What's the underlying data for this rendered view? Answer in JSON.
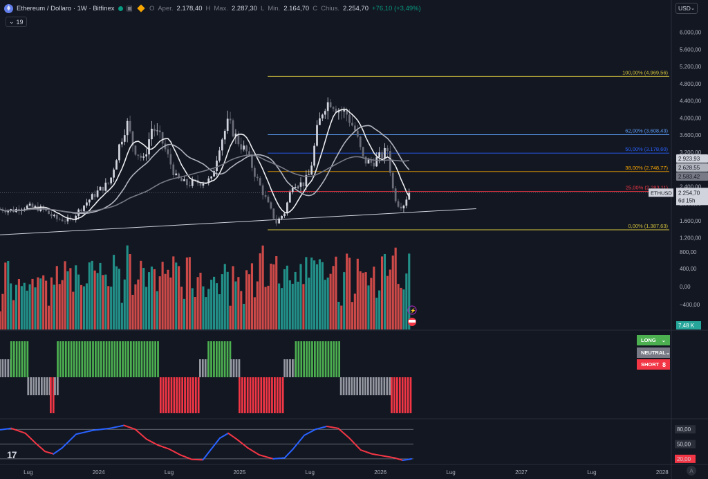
{
  "header": {
    "symbol": "Ethereum / Dollaro · 1W · Bitfinex",
    "open_label": "O",
    "open_key": "Aper.",
    "open": "2.178,40",
    "high_label": "H",
    "high_key": "Max.",
    "high": "2.287,30",
    "low_label": "L",
    "low_key": "Min.",
    "low": "2.164,70",
    "close_label": "C",
    "close_key": "Chius.",
    "close": "2.254,70",
    "change": "+76,10 (+3,49%)"
  },
  "indicator_count": "19",
  "currency": "USD",
  "price_tag": {
    "label": "ETHUSD",
    "price": "2.254,70",
    "countdown": "6d 15h"
  },
  "ma_tags": [
    "2.923,93",
    "2.628,55",
    "2.583,42"
  ],
  "volume_tag": "7,48 K",
  "signal_pills": {
    "long": "LONG",
    "neutral": "NEUTRAL",
    "short": "SHORT",
    "short_count": "8"
  },
  "osc_tags": [
    "80,00",
    "50,00",
    "20,00"
  ],
  "colors": {
    "bg": "#131722",
    "up": "#26a69a",
    "down": "#ef5350",
    "long": "#4caf50",
    "short": "#f23645",
    "neutral": "#9598a1",
    "osc_up": "#2962ff",
    "osc_down": "#f23645",
    "fib_yellow": "#d6c43c",
    "fib_orange": "#f7a600",
    "fib_blue": "#2962ff"
  },
  "icons": [
    "ethereum-coin-icon",
    "market-status-dot-icon",
    "favorite-icon",
    "flag-diamond-icon",
    "chevron-down-icon",
    "lightning-icon",
    "us-flag-icon",
    "tradingview-logo-icon"
  ],
  "chart_data": {
    "type": "candlestick",
    "axis": {
      "price_ticks": [
        "6.000,00",
        "5.600,00",
        "5.200,00",
        "4.800,00",
        "4.400,00",
        "4.000,00",
        "3.600,00",
        "3.200,00",
        "2.800,00",
        "2.400,00",
        "2.000,00",
        "1.600,00",
        "1.200,00"
      ],
      "price_range": [
        1000,
        6300
      ],
      "volume_ticks": [
        "800,00",
        "400,00",
        "0,00",
        "−400,00"
      ],
      "x_ticks": [
        {
          "label": "Lug",
          "t": 2023.5
        },
        {
          "label": "2024",
          "t": 2024.0
        },
        {
          "label": "Lug",
          "t": 2024.5
        },
        {
          "label": "2025",
          "t": 2025.0
        },
        {
          "label": "Lug",
          "t": 2025.5
        },
        {
          "label": "2026",
          "t": 2026.0
        },
        {
          "label": "Lug",
          "t": 2026.5
        },
        {
          "label": "2027",
          "t": 2027.0
        },
        {
          "label": "Lug",
          "t": 2027.5
        },
        {
          "label": "2028",
          "t": 2028.0
        }
      ],
      "x_range": [
        2023.3,
        2028.06
      ]
    },
    "fib_levels": [
      {
        "label": "100,00% (4.969,56)",
        "value": 4969.56,
        "color": "#d6c43c"
      },
      {
        "label": "62,00% (3.608,43)",
        "value": 3608.43,
        "color": "#5b9cf6"
      },
      {
        "label": "50,00% (3.178,60)",
        "value": 3178.6,
        "color": "#2962ff"
      },
      {
        "label": "38,00% (2.748,77)",
        "value": 2748.77,
        "color": "#f7a600"
      },
      {
        "label": "25,00% (2.283,11)",
        "value": 2283.11,
        "color": "#f23645"
      },
      {
        "label": "0,00% (1.387,63)",
        "value": 1387.63,
        "color": "#d6c43c"
      }
    ],
    "trendline": [
      {
        "t": 2023.3,
        "p": 1270
      },
      {
        "t": 2026.68,
        "p": 1880
      }
    ],
    "close_keypoints": [
      {
        "t": 2023.3,
        "p": 1870
      },
      {
        "t": 2023.4,
        "p": 1840
      },
      {
        "t": 2023.45,
        "p": 1920
      },
      {
        "t": 2023.5,
        "p": 1930
      },
      {
        "t": 2023.6,
        "p": 1870
      },
      {
        "t": 2023.7,
        "p": 1640
      },
      {
        "t": 2023.8,
        "p": 1600
      },
      {
        "t": 2023.85,
        "p": 1800
      },
      {
        "t": 2023.92,
        "p": 2050
      },
      {
        "t": 2024.0,
        "p": 2300
      },
      {
        "t": 2024.08,
        "p": 2500
      },
      {
        "t": 2024.15,
        "p": 3400
      },
      {
        "t": 2024.2,
        "p": 3900
      },
      {
        "t": 2024.25,
        "p": 3300
      },
      {
        "t": 2024.32,
        "p": 3000
      },
      {
        "t": 2024.38,
        "p": 3800
      },
      {
        "t": 2024.45,
        "p": 3450
      },
      {
        "t": 2024.55,
        "p": 2600
      },
      {
        "t": 2024.62,
        "p": 2450
      },
      {
        "t": 2024.72,
        "p": 2500
      },
      {
        "t": 2024.8,
        "p": 2550
      },
      {
        "t": 2024.86,
        "p": 3400
      },
      {
        "t": 2024.92,
        "p": 3900
      },
      {
        "t": 2025.0,
        "p": 3400
      },
      {
        "t": 2025.05,
        "p": 3200
      },
      {
        "t": 2025.12,
        "p": 2600
      },
      {
        "t": 2025.2,
        "p": 2000
      },
      {
        "t": 2025.26,
        "p": 1550
      },
      {
        "t": 2025.32,
        "p": 1800
      },
      {
        "t": 2025.38,
        "p": 2500
      },
      {
        "t": 2025.45,
        "p": 2450
      },
      {
        "t": 2025.5,
        "p": 2700
      },
      {
        "t": 2025.55,
        "p": 3700
      },
      {
        "t": 2025.6,
        "p": 4300
      },
      {
        "t": 2025.65,
        "p": 4400
      },
      {
        "t": 2025.7,
        "p": 4200
      },
      {
        "t": 2025.76,
        "p": 4100
      },
      {
        "t": 2025.82,
        "p": 3700
      },
      {
        "t": 2025.88,
        "p": 3000
      },
      {
        "t": 2025.94,
        "p": 2950
      },
      {
        "t": 2026.0,
        "p": 3100
      },
      {
        "t": 2026.05,
        "p": 3250
      },
      {
        "t": 2026.09,
        "p": 2300
      },
      {
        "t": 2026.12,
        "p": 2000
      },
      {
        "t": 2026.16,
        "p": 1950
      },
      {
        "t": 2026.2,
        "p": 2254.7
      }
    ],
    "moving_averages": [
      {
        "name": "",
        "window": 8,
        "color": "#ebecef"
      },
      {
        "name": "",
        "window": 21,
        "color": "#b2b5be"
      },
      {
        "name": "",
        "window": 50,
        "color": "#787b86"
      }
    ],
    "signal_segments": [
      {
        "state": "neutral",
        "t0": 2023.3,
        "t1": 2023.38
      },
      {
        "state": "long",
        "t0": 2023.38,
        "t1": 2023.5
      },
      {
        "state": "neutral",
        "t0": 2023.5,
        "t1": 2023.66
      },
      {
        "state": "short",
        "t0": 2023.66,
        "t1": 2023.69
      },
      {
        "state": "neutral",
        "t0": 2023.69,
        "t1": 2023.71
      },
      {
        "state": "long",
        "t0": 2023.71,
        "t1": 2024.44
      },
      {
        "state": "short",
        "t0": 2024.44,
        "t1": 2024.72
      },
      {
        "state": "neutral",
        "t0": 2024.72,
        "t1": 2024.78
      },
      {
        "state": "long",
        "t0": 2024.78,
        "t1": 2024.94
      },
      {
        "state": "neutral",
        "t0": 2024.94,
        "t1": 2025.0
      },
      {
        "state": "short",
        "t0": 2025.0,
        "t1": 2025.32
      },
      {
        "state": "neutral",
        "t0": 2025.32,
        "t1": 2025.4
      },
      {
        "state": "long",
        "t0": 2025.4,
        "t1": 2025.72
      },
      {
        "state": "neutral",
        "t0": 2025.72,
        "t1": 2026.08
      },
      {
        "state": "short",
        "t0": 2026.08,
        "t1": 2026.22
      }
    ],
    "oscillator": {
      "levels": [
        80,
        50,
        20
      ],
      "range": [
        10,
        100
      ],
      "keypoints": [
        {
          "t": 2023.3,
          "v": 79
        },
        {
          "t": 2023.38,
          "v": 82
        },
        {
          "t": 2023.48,
          "v": 72
        },
        {
          "t": 2023.56,
          "v": 50
        },
        {
          "t": 2023.62,
          "v": 35
        },
        {
          "t": 2023.68,
          "v": 30
        },
        {
          "t": 2023.74,
          "v": 42
        },
        {
          "t": 2023.84,
          "v": 70
        },
        {
          "t": 2023.96,
          "v": 78
        },
        {
          "t": 2024.08,
          "v": 82
        },
        {
          "t": 2024.18,
          "v": 88
        },
        {
          "t": 2024.26,
          "v": 80
        },
        {
          "t": 2024.34,
          "v": 60
        },
        {
          "t": 2024.42,
          "v": 48
        },
        {
          "t": 2024.5,
          "v": 40
        },
        {
          "t": 2024.58,
          "v": 28
        },
        {
          "t": 2024.66,
          "v": 19
        },
        {
          "t": 2024.74,
          "v": 18
        },
        {
          "t": 2024.8,
          "v": 40
        },
        {
          "t": 2024.86,
          "v": 62
        },
        {
          "t": 2024.92,
          "v": 72
        },
        {
          "t": 2024.98,
          "v": 60
        },
        {
          "t": 2025.06,
          "v": 42
        },
        {
          "t": 2025.14,
          "v": 28
        },
        {
          "t": 2025.24,
          "v": 20
        },
        {
          "t": 2025.32,
          "v": 22
        },
        {
          "t": 2025.38,
          "v": 40
        },
        {
          "t": 2025.46,
          "v": 68
        },
        {
          "t": 2025.54,
          "v": 80
        },
        {
          "t": 2025.62,
          "v": 86
        },
        {
          "t": 2025.7,
          "v": 82
        },
        {
          "t": 2025.78,
          "v": 62
        },
        {
          "t": 2025.86,
          "v": 38
        },
        {
          "t": 2025.94,
          "v": 30
        },
        {
          "t": 2026.02,
          "v": 26
        },
        {
          "t": 2026.1,
          "v": 22
        },
        {
          "t": 2026.16,
          "v": 17
        },
        {
          "t": 2026.22,
          "v": 20
        }
      ]
    }
  }
}
